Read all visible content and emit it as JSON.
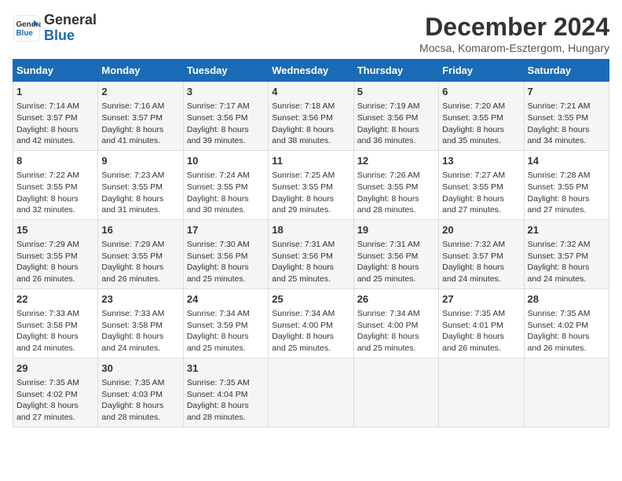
{
  "logo": {
    "line1": "General",
    "line2": "Blue"
  },
  "title": "December 2024",
  "subtitle": "Mocsa, Komarom-Esztergom, Hungary",
  "days_of_week": [
    "Sunday",
    "Monday",
    "Tuesday",
    "Wednesday",
    "Thursday",
    "Friday",
    "Saturday"
  ],
  "weeks": [
    [
      {
        "day": 1,
        "info": "Sunrise: 7:14 AM\nSunset: 3:57 PM\nDaylight: 8 hours\nand 42 minutes."
      },
      {
        "day": 2,
        "info": "Sunrise: 7:16 AM\nSunset: 3:57 PM\nDaylight: 8 hours\nand 41 minutes."
      },
      {
        "day": 3,
        "info": "Sunrise: 7:17 AM\nSunset: 3:56 PM\nDaylight: 8 hours\nand 39 minutes."
      },
      {
        "day": 4,
        "info": "Sunrise: 7:18 AM\nSunset: 3:56 PM\nDaylight: 8 hours\nand 38 minutes."
      },
      {
        "day": 5,
        "info": "Sunrise: 7:19 AM\nSunset: 3:56 PM\nDaylight: 8 hours\nand 36 minutes."
      },
      {
        "day": 6,
        "info": "Sunrise: 7:20 AM\nSunset: 3:55 PM\nDaylight: 8 hours\nand 35 minutes."
      },
      {
        "day": 7,
        "info": "Sunrise: 7:21 AM\nSunset: 3:55 PM\nDaylight: 8 hours\nand 34 minutes."
      }
    ],
    [
      {
        "day": 8,
        "info": "Sunrise: 7:22 AM\nSunset: 3:55 PM\nDaylight: 8 hours\nand 32 minutes."
      },
      {
        "day": 9,
        "info": "Sunrise: 7:23 AM\nSunset: 3:55 PM\nDaylight: 8 hours\nand 31 minutes."
      },
      {
        "day": 10,
        "info": "Sunrise: 7:24 AM\nSunset: 3:55 PM\nDaylight: 8 hours\nand 30 minutes."
      },
      {
        "day": 11,
        "info": "Sunrise: 7:25 AM\nSunset: 3:55 PM\nDaylight: 8 hours\nand 29 minutes."
      },
      {
        "day": 12,
        "info": "Sunrise: 7:26 AM\nSunset: 3:55 PM\nDaylight: 8 hours\nand 28 minutes."
      },
      {
        "day": 13,
        "info": "Sunrise: 7:27 AM\nSunset: 3:55 PM\nDaylight: 8 hours\nand 27 minutes."
      },
      {
        "day": 14,
        "info": "Sunrise: 7:28 AM\nSunset: 3:55 PM\nDaylight: 8 hours\nand 27 minutes."
      }
    ],
    [
      {
        "day": 15,
        "info": "Sunrise: 7:29 AM\nSunset: 3:55 PM\nDaylight: 8 hours\nand 26 minutes."
      },
      {
        "day": 16,
        "info": "Sunrise: 7:29 AM\nSunset: 3:55 PM\nDaylight: 8 hours\nand 26 minutes."
      },
      {
        "day": 17,
        "info": "Sunrise: 7:30 AM\nSunset: 3:56 PM\nDaylight: 8 hours\nand 25 minutes."
      },
      {
        "day": 18,
        "info": "Sunrise: 7:31 AM\nSunset: 3:56 PM\nDaylight: 8 hours\nand 25 minutes."
      },
      {
        "day": 19,
        "info": "Sunrise: 7:31 AM\nSunset: 3:56 PM\nDaylight: 8 hours\nand 25 minutes."
      },
      {
        "day": 20,
        "info": "Sunrise: 7:32 AM\nSunset: 3:57 PM\nDaylight: 8 hours\nand 24 minutes."
      },
      {
        "day": 21,
        "info": "Sunrise: 7:32 AM\nSunset: 3:57 PM\nDaylight: 8 hours\nand 24 minutes."
      }
    ],
    [
      {
        "day": 22,
        "info": "Sunrise: 7:33 AM\nSunset: 3:58 PM\nDaylight: 8 hours\nand 24 minutes."
      },
      {
        "day": 23,
        "info": "Sunrise: 7:33 AM\nSunset: 3:58 PM\nDaylight: 8 hours\nand 24 minutes."
      },
      {
        "day": 24,
        "info": "Sunrise: 7:34 AM\nSunset: 3:59 PM\nDaylight: 8 hours\nand 25 minutes."
      },
      {
        "day": 25,
        "info": "Sunrise: 7:34 AM\nSunset: 4:00 PM\nDaylight: 8 hours\nand 25 minutes."
      },
      {
        "day": 26,
        "info": "Sunrise: 7:34 AM\nSunset: 4:00 PM\nDaylight: 8 hours\nand 25 minutes."
      },
      {
        "day": 27,
        "info": "Sunrise: 7:35 AM\nSunset: 4:01 PM\nDaylight: 8 hours\nand 26 minutes."
      },
      {
        "day": 28,
        "info": "Sunrise: 7:35 AM\nSunset: 4:02 PM\nDaylight: 8 hours\nand 26 minutes."
      }
    ],
    [
      {
        "day": 29,
        "info": "Sunrise: 7:35 AM\nSunset: 4:02 PM\nDaylight: 8 hours\nand 27 minutes."
      },
      {
        "day": 30,
        "info": "Sunrise: 7:35 AM\nSunset: 4:03 PM\nDaylight: 8 hours\nand 28 minutes."
      },
      {
        "day": 31,
        "info": "Sunrise: 7:35 AM\nSunset: 4:04 PM\nDaylight: 8 hours\nand 28 minutes."
      },
      null,
      null,
      null,
      null
    ]
  ]
}
